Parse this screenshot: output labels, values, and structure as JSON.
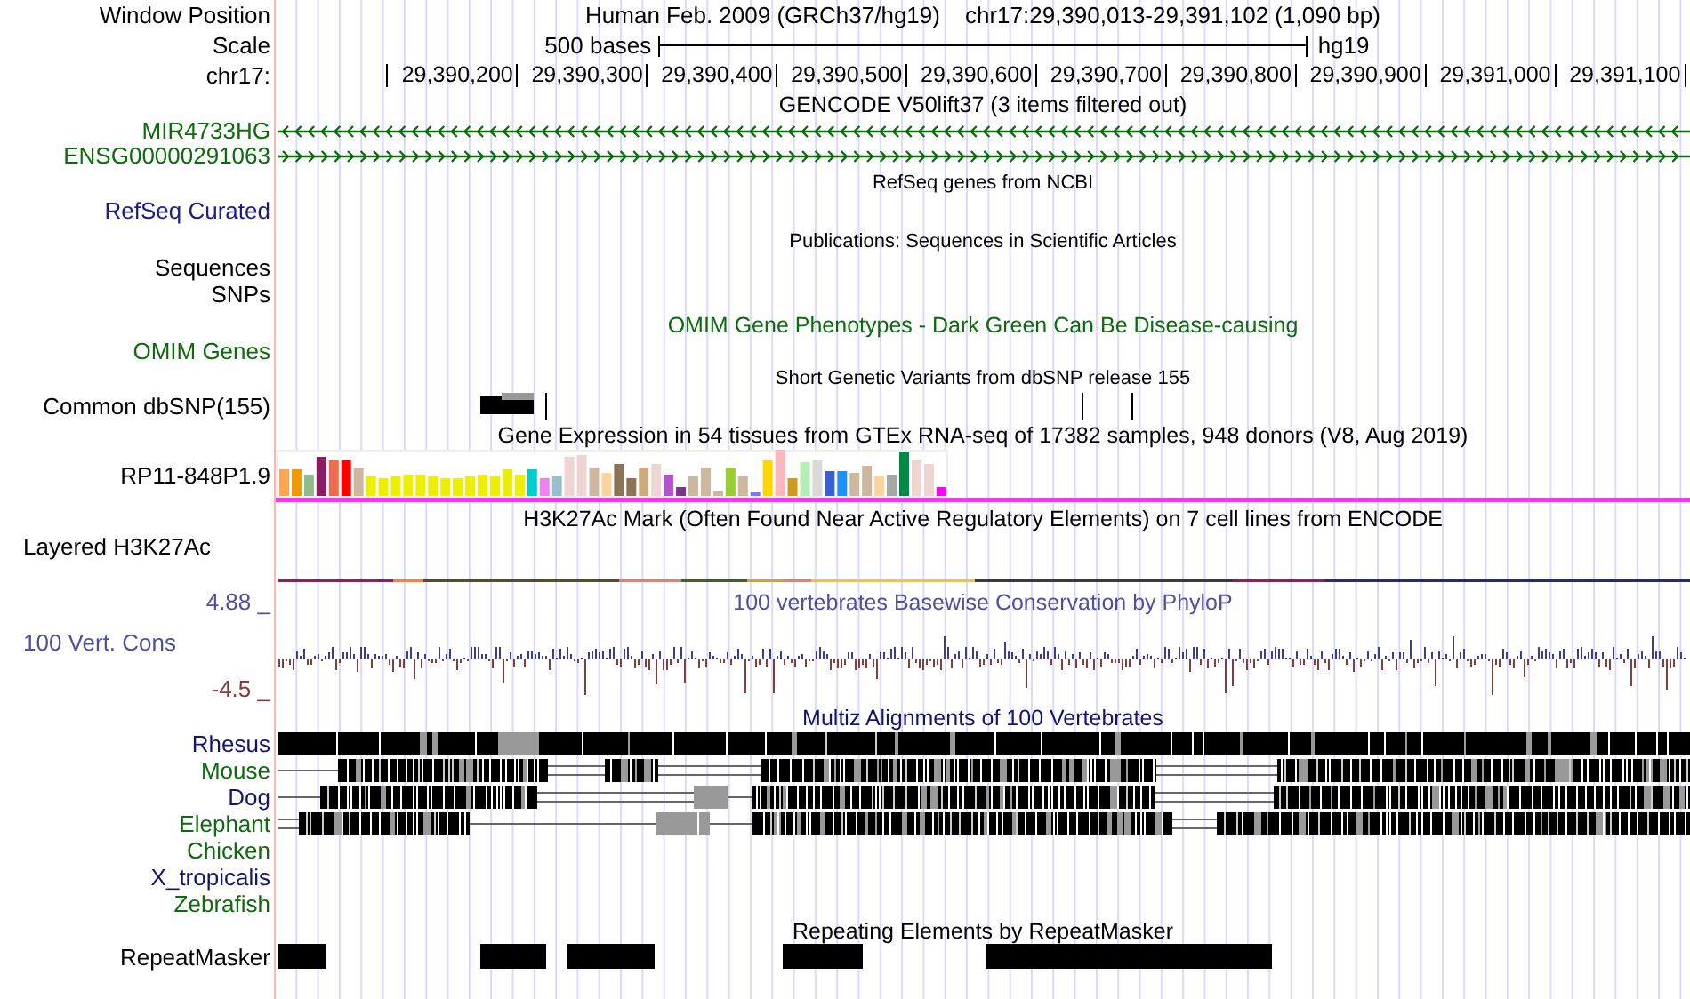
{
  "header": {
    "label": "Window Position",
    "assembly": "Human Feb. 2009 (GRCh37/hg19)",
    "position": "chr17:29,390,013-29,391,102 (1,090 bp)"
  },
  "scale": {
    "label": "Scale",
    "length": "500 bases",
    "genome": "hg19"
  },
  "ruler": {
    "label": "chr17:",
    "ticks": [
      "29,390,200",
      "29,390,300",
      "29,390,400",
      "29,390,500",
      "29,390,600",
      "29,390,700",
      "29,390,800",
      "29,390,900",
      "29,391,000",
      "29,391,100"
    ]
  },
  "tracks": [
    {
      "kind": "genes",
      "title": {
        "text": "GENCODE V50lift37 (3 items filtered out)",
        "color": "#000000"
      },
      "items": [
        {
          "label": "MIR4733HG",
          "color": "#0c6c0c",
          "reverse": true
        },
        {
          "label": "ENSG00000291063",
          "color": "#0c6c0c",
          "reverse": false
        }
      ]
    },
    {
      "kind": "refseq",
      "title": {
        "text": "RefSeq genes from NCBI",
        "color": "#000000"
      },
      "labels": [
        {
          "text": "RefSeq Curated",
          "color": "#1c1c86"
        }
      ]
    },
    {
      "kind": "pubs",
      "title": {
        "text": "Publications: Sequences in Scientific Articles",
        "color": "#000000"
      },
      "labels": [
        {
          "text": "Sequences",
          "color": "#000000"
        },
        {
          "text": "SNPs",
          "color": "#000000"
        }
      ]
    },
    {
      "kind": "omim",
      "title": {
        "text": "OMIM Gene Phenotypes - Dark Green Can Be Disease-causing",
        "color": "#0c6c0c"
      },
      "labels": [
        {
          "text": "OMIM Genes",
          "color": "#0c6c0c"
        }
      ]
    },
    {
      "kind": "dbsnp",
      "title": {
        "text": "Short Genetic Variants from dbSNP release 155",
        "color": "#000000"
      },
      "labels": [
        {
          "text": "Common dbSNP(155)",
          "color": "#000000"
        }
      ]
    },
    {
      "kind": "gtex",
      "title": {
        "text": "Gene Expression in 54 tissues from GTEx RNA-seq of 17382 samples, 948 donors (V8, Aug 2019)",
        "color": "#000000"
      },
      "labels": [
        {
          "text": "RP11-848P1.9",
          "color": "#000000"
        }
      ]
    },
    {
      "kind": "h3k27ac",
      "title": {
        "text": "H3K27Ac Mark (Often Found Near Active Regulatory Elements) on 7 cell lines from ENCODE",
        "color": "#000000"
      },
      "labels": [
        {
          "text": "Layered H3K27Ac",
          "color": "#000000"
        }
      ]
    },
    {
      "kind": "phylop",
      "title": {
        "text": "100 vertebrates Basewise Conservation by PhyloP",
        "color": "#4f4f9f"
      },
      "labels": [
        {
          "text": "4.88 _",
          "color": "#4f4f9f"
        },
        {
          "text": "100 Vert. Cons",
          "color": "#4f4f9f"
        },
        {
          "text": "-4.5 _",
          "color": "#8b3a3a"
        }
      ]
    },
    {
      "kind": "multiz",
      "title": {
        "text": "Multiz Alignments of 100 Vertebrates",
        "color": "#14146e"
      },
      "species": [
        {
          "label": "Rhesus",
          "color": "#14146e",
          "aligned": true
        },
        {
          "label": "Mouse",
          "color": "#0c6c0c",
          "aligned": true
        },
        {
          "label": "Dog",
          "color": "#14146e",
          "aligned": true
        },
        {
          "label": "Elephant",
          "color": "#0c6c0c",
          "aligned": true
        },
        {
          "label": "Chicken",
          "color": "#0c6c0c",
          "aligned": false
        },
        {
          "label": "X_tropicalis",
          "color": "#14146e",
          "aligned": false
        },
        {
          "label": "Zebrafish",
          "color": "#0c6c0c",
          "aligned": false
        }
      ]
    },
    {
      "kind": "rmsk",
      "title": {
        "text": "Repeating Elements by RepeatMasker",
        "color": "#000000"
      },
      "labels": [
        {
          "text": "RepeatMasker",
          "color": "#000000"
        }
      ]
    }
  ]
}
